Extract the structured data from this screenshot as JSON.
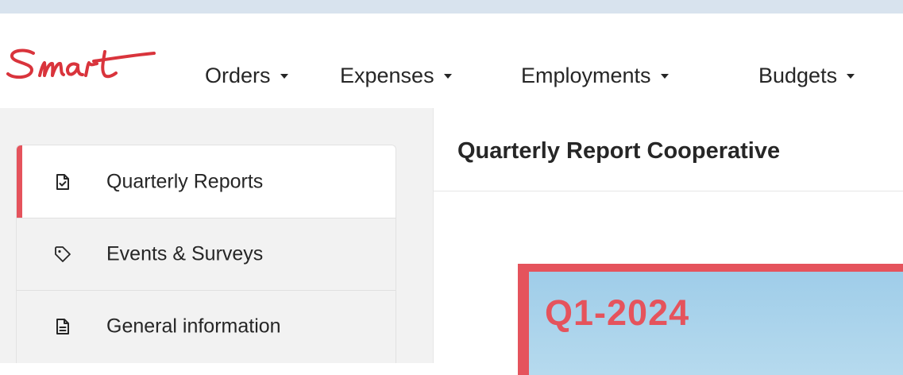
{
  "brand": {
    "logo_text": "Smart",
    "accent_color": "#e5535c",
    "logo_color": "#d9343c"
  },
  "nav": {
    "items": [
      {
        "label": "Orders",
        "icon": "caret-down-icon"
      },
      {
        "label": "Expenses",
        "icon": "caret-down-icon"
      },
      {
        "label": "Employments",
        "icon": "caret-down-icon"
      },
      {
        "label": "Budgets",
        "icon": "caret-down-icon"
      }
    ]
  },
  "sidebar": {
    "items": [
      {
        "label": "Quarterly Reports",
        "icon": "file-check-icon",
        "active": true
      },
      {
        "label": "Events & Surveys",
        "icon": "tag-icon",
        "active": false
      },
      {
        "label": "General information",
        "icon": "document-icon",
        "active": false
      }
    ]
  },
  "main": {
    "title": "Quarterly Report Cooperative",
    "report_card": {
      "label": "Q1-2024",
      "background_color": "#a8d3ec",
      "border_color": "#e5535c"
    }
  }
}
